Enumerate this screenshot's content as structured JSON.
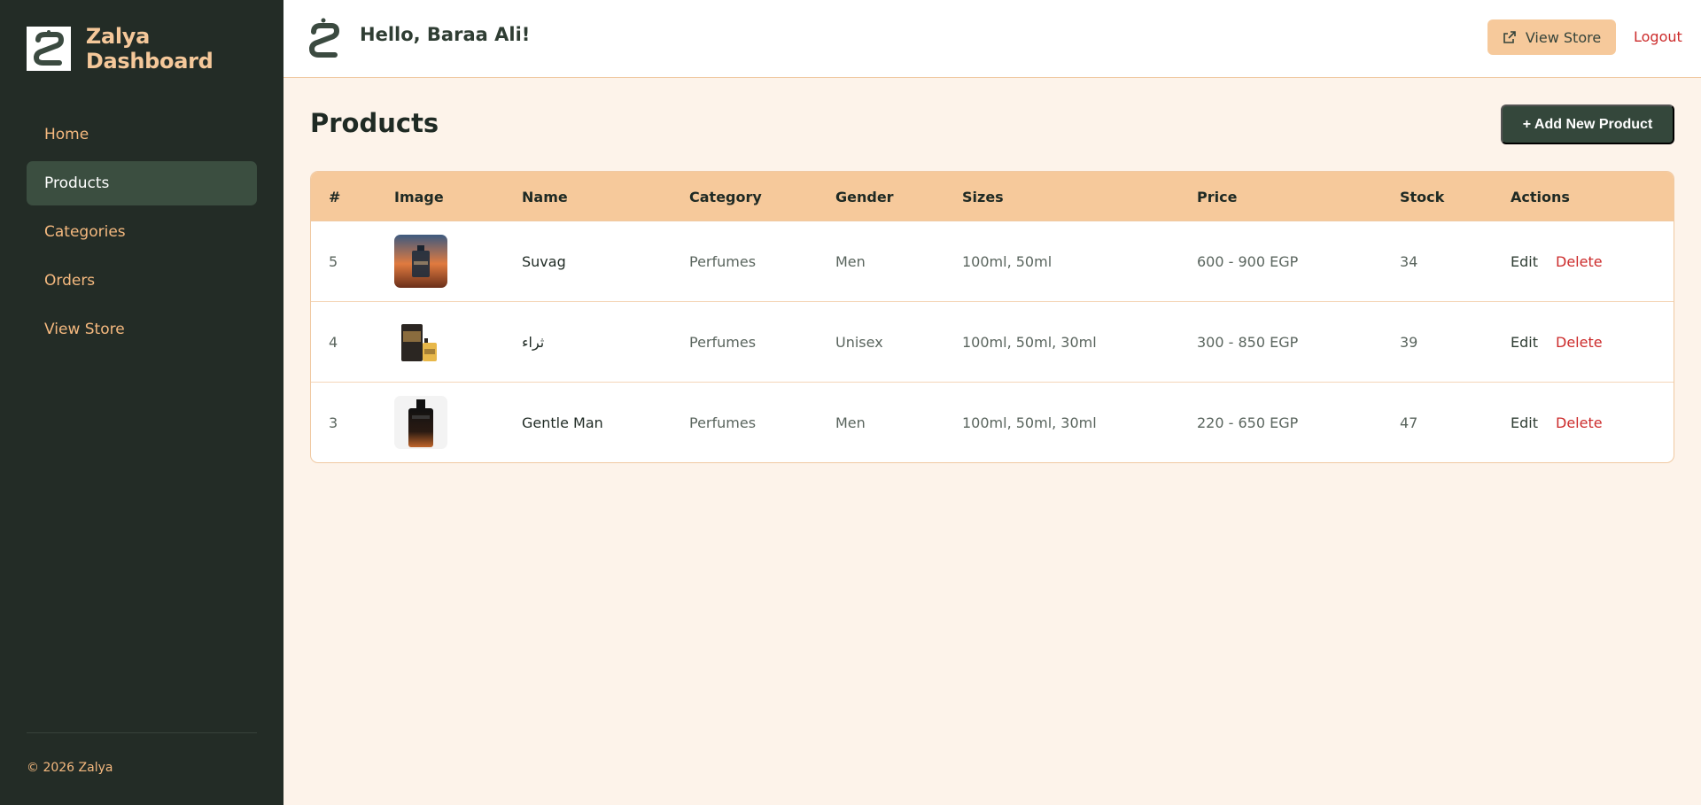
{
  "sidebar": {
    "brand_title": "Zalya Dashboard",
    "nav": [
      {
        "label": "Home"
      },
      {
        "label": "Products"
      },
      {
        "label": "Categories"
      },
      {
        "label": "Orders"
      },
      {
        "label": "View Store"
      }
    ],
    "active_index": 1,
    "footer": "© 2026 Zalya"
  },
  "header": {
    "greeting": "Hello, Baraa Ali!",
    "view_store_label": "View Store",
    "logout_label": "Logout"
  },
  "main": {
    "title": "Products",
    "add_button_label": "+ Add New Product",
    "columns": [
      "#",
      "Image",
      "Name",
      "Category",
      "Gender",
      "Sizes",
      "Price",
      "Stock",
      "Actions"
    ],
    "rows": [
      {
        "id": "5",
        "name": "Suvag",
        "category": "Perfumes",
        "gender": "Men",
        "sizes": "100ml, 50ml",
        "price": "600 - 900 EGP",
        "stock": "34"
      },
      {
        "id": "4",
        "name": "ثراء",
        "category": "Perfumes",
        "gender": "Unisex",
        "sizes": "100ml, 50ml, 30ml",
        "price": "300 - 850 EGP",
        "stock": "39"
      },
      {
        "id": "3",
        "name": "Gentle Man",
        "category": "Perfumes",
        "gender": "Men",
        "sizes": "100ml, 50ml, 30ml",
        "price": "220 - 650 EGP",
        "stock": "47"
      }
    ],
    "edit_label": "Edit",
    "delete_label": "Delete"
  },
  "colors": {
    "sidebar_bg": "#232c26",
    "accent": "#f6c99b",
    "brand_text": "#f5c89a",
    "danger": "#cc2b2b",
    "page_bg": "#fdf3ea",
    "primary_button": "#34473b"
  },
  "icons": {
    "brand": "zalya-logo-icon",
    "external": "external-link-icon"
  }
}
